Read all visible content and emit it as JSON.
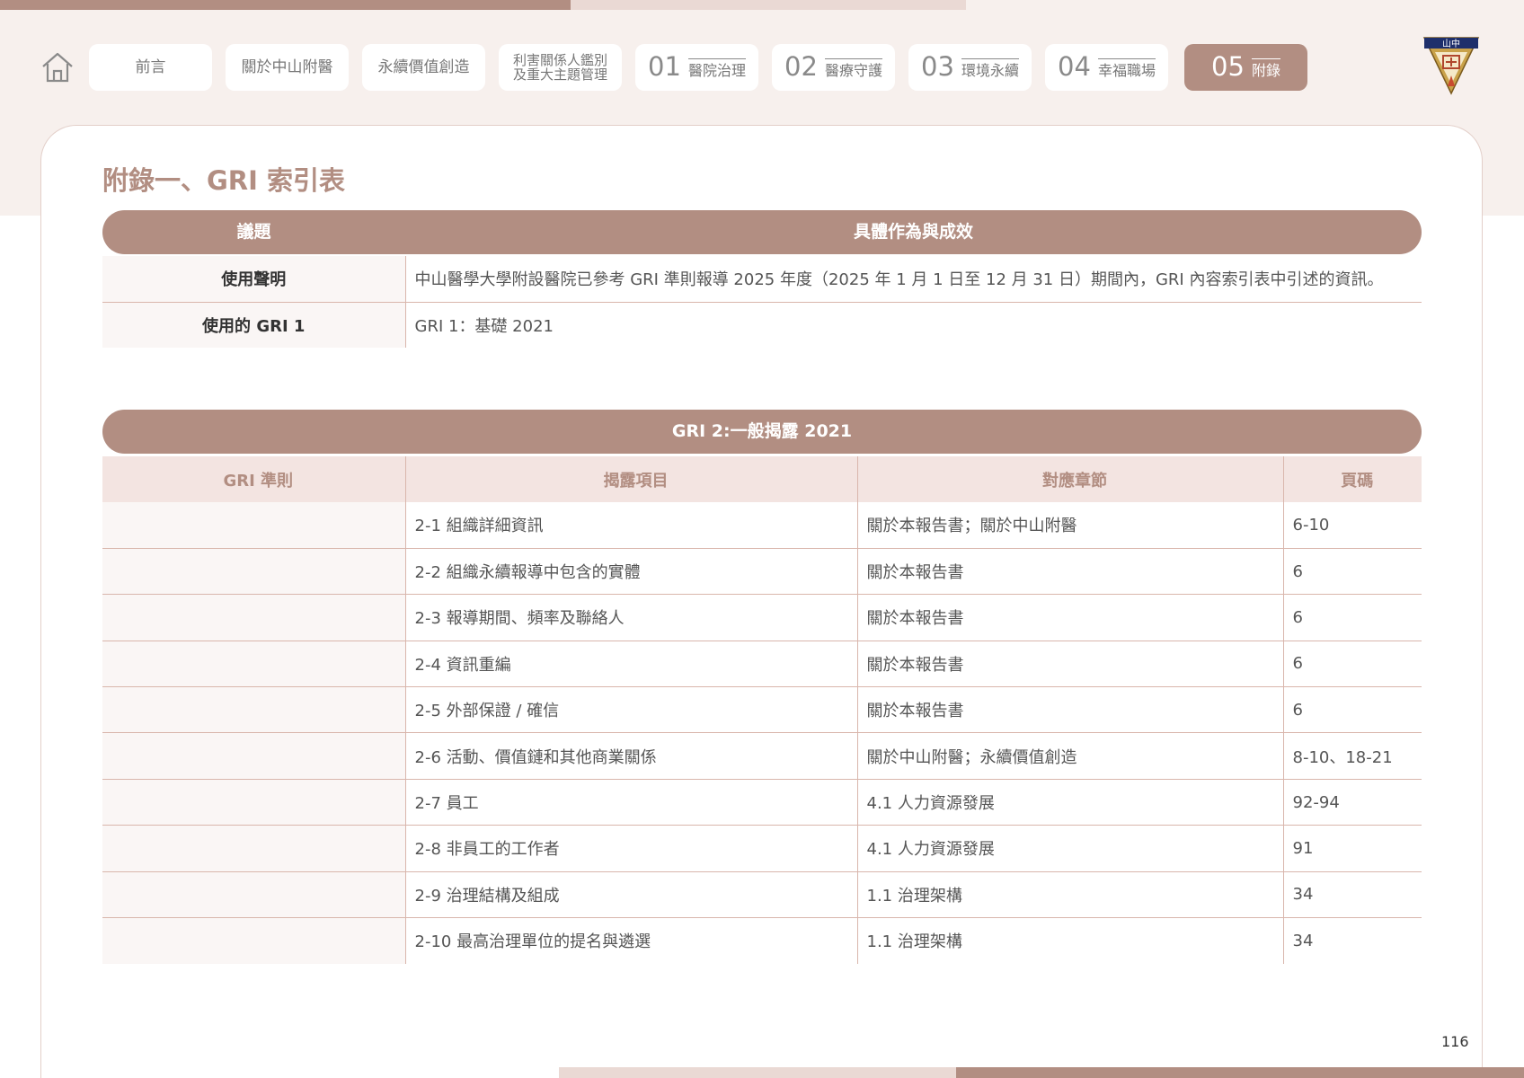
{
  "nav": {
    "items": [
      {
        "label": "前言"
      },
      {
        "label": "關於中山附醫"
      },
      {
        "label": "永續價值創造"
      },
      {
        "line1": "利害關係人鑑別",
        "line2": "及重大主題管理"
      },
      {
        "num": "01",
        "label": "醫院治理"
      },
      {
        "num": "02",
        "label": "醫療守護"
      },
      {
        "num": "03",
        "label": "環境永續"
      },
      {
        "num": "04",
        "label": "幸福職場"
      },
      {
        "num": "05",
        "label": "附錄"
      }
    ],
    "active_index": 8
  },
  "logo": {
    "text": "山中"
  },
  "page_title": "附錄一、GRI 索引表",
  "statement_table": {
    "header_left": "議題",
    "header_right": "具體作為與成效",
    "rows": [
      {
        "key": "使用聲明",
        "value": "中山醫學大學附設醫院已參考 GRI 準則報導 2025 年度（2025 年 1 月 1 日至 12 月 31 日）期間內，GRI 內容索引表中引述的資訊。"
      },
      {
        "key": "使用的 GRI 1",
        "value": "GRI 1：基礎 2021"
      }
    ]
  },
  "gri2_table": {
    "banner": "GRI 2:一般揭露 2021",
    "columns": [
      "GRI 準則",
      "揭露項目",
      "對應章節",
      "頁碼"
    ],
    "rows": [
      {
        "item": "2-1 組織詳細資訊",
        "section": "關於本報告書；關於中山附醫",
        "page": "6-10"
      },
      {
        "item": "2-2 組織永續報導中包含的實體",
        "section": "關於本報告書",
        "page": "6"
      },
      {
        "item": "2-3 報導期間、頻率及聯絡人",
        "section": "關於本報告書",
        "page": "6"
      },
      {
        "item": "2-4 資訊重編",
        "section": "關於本報告書",
        "page": "6"
      },
      {
        "item": "2-5 外部保證 / 確信",
        "section": "關於本報告書",
        "page": "6"
      },
      {
        "item": "2-6 活動、價值鏈和其他商業關係",
        "section": "關於中山附醫；永續價值創造",
        "page": "8-10、18-21"
      },
      {
        "item": "2-7 員工",
        "section": "4.1 人力資源發展",
        "page": "92-94"
      },
      {
        "item": "2-8 非員工的工作者",
        "section": "4.1 人力資源發展",
        "page": "91"
      },
      {
        "item": "2-9 治理結構及組成",
        "section": "1.1 治理架構",
        "page": "34"
      },
      {
        "item": "2-10 最高治理單位的提名與遴選",
        "section": "1.1 治理架構",
        "page": "34"
      }
    ]
  },
  "page_number": "116",
  "colors": {
    "accent": "#b28e82",
    "light": "#ead9d4",
    "header_bg": "#f3e4e1",
    "top_bg": "#f7f0ed"
  }
}
